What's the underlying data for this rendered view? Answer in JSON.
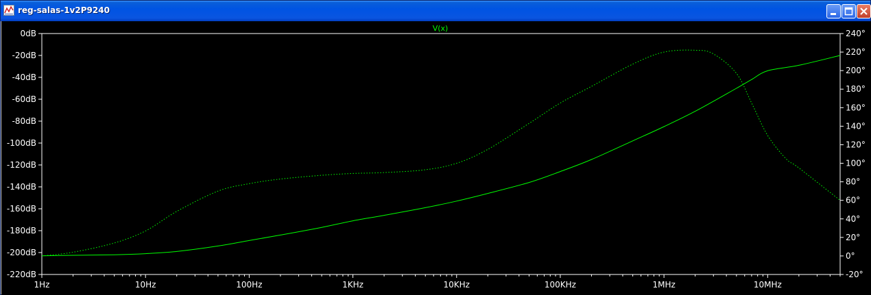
{
  "window": {
    "title": "reg-salas-1v2P9240",
    "icon": "waveform-viewer-icon",
    "buttons": {
      "minimize": "minimize-icon",
      "maximize": "maximize-icon",
      "close": "close-icon"
    }
  },
  "colors": {
    "background": "#000000",
    "trace": "#00ff00",
    "text": "#ffffff",
    "titlebar": "#0054e3"
  },
  "chart_data": {
    "type": "line",
    "title": "V(x)",
    "x_scale": "log",
    "xlim": [
      1,
      50000000
    ],
    "x_ticks": [
      {
        "value": 1,
        "label": "1Hz"
      },
      {
        "value": 10,
        "label": "10Hz"
      },
      {
        "value": 100,
        "label": "100Hz"
      },
      {
        "value": 1000,
        "label": "1KHz"
      },
      {
        "value": 10000,
        "label": "10KHz"
      },
      {
        "value": 100000,
        "label": "100KHz"
      },
      {
        "value": 1000000,
        "label": "1MHz"
      },
      {
        "value": 10000000,
        "label": "10MHz"
      }
    ],
    "y_left": {
      "ylim": [
        -220,
        0
      ],
      "ticks": [
        {
          "value": 0,
          "label": "0dB"
        },
        {
          "value": -20,
          "label": "-20dB"
        },
        {
          "value": -40,
          "label": "-40dB"
        },
        {
          "value": -60,
          "label": "-60dB"
        },
        {
          "value": -80,
          "label": "-80dB"
        },
        {
          "value": -100,
          "label": "-100dB"
        },
        {
          "value": -120,
          "label": "-120dB"
        },
        {
          "value": -140,
          "label": "-140dB"
        },
        {
          "value": -160,
          "label": "-160dB"
        },
        {
          "value": -180,
          "label": "-180dB"
        },
        {
          "value": -200,
          "label": "-200dB"
        },
        {
          "value": -220,
          "label": "-220dB"
        }
      ]
    },
    "y_right": {
      "ylim": [
        -20,
        240
      ],
      "ticks": [
        {
          "value": 240,
          "label": "240°"
        },
        {
          "value": 220,
          "label": "220°"
        },
        {
          "value": 200,
          "label": "200°"
        },
        {
          "value": 180,
          "label": "180°"
        },
        {
          "value": 160,
          "label": "160°"
        },
        {
          "value": 140,
          "label": "140°"
        },
        {
          "value": 120,
          "label": "120°"
        },
        {
          "value": 100,
          "label": "100°"
        },
        {
          "value": 80,
          "label": "80°"
        },
        {
          "value": 60,
          "label": "60°"
        },
        {
          "value": 40,
          "label": "40°"
        },
        {
          "value": 20,
          "label": "20°"
        },
        {
          "value": 0,
          "label": "0°"
        },
        {
          "value": -20,
          "label": "-20°"
        }
      ]
    },
    "grid": false,
    "series": [
      {
        "axis": "left",
        "style": "solid",
        "x": [
          1,
          2,
          5,
          10,
          20,
          50,
          100,
          200,
          500,
          1000,
          2000,
          5000,
          10000,
          20000,
          50000,
          100000,
          200000,
          500000,
          1000000,
          2000000,
          5000000,
          7000000,
          10000000,
          20000000,
          50000000
        ],
        "y": [
          -203,
          -202.5,
          -202,
          -201,
          -199,
          -194,
          -189,
          -184,
          -177,
          -171,
          -166,
          -159,
          -153,
          -146,
          -136,
          -126,
          -115,
          -98,
          -85,
          -71,
          -50,
          -42,
          -34,
          -29,
          -20
        ]
      },
      {
        "axis": "right",
        "style": "dotted",
        "x": [
          1,
          2,
          5,
          10,
          20,
          50,
          100,
          200,
          500,
          1000,
          2000,
          5000,
          10000,
          20000,
          50000,
          100000,
          200000,
          500000,
          1000000,
          2000000,
          3000000,
          5000000,
          7000000,
          10000000,
          15000000,
          20000000,
          50000000
        ],
        "y": [
          0,
          4,
          14,
          27,
          48,
          70,
          78,
          83,
          87,
          89,
          90,
          93,
          100,
          115,
          143,
          165,
          183,
          207,
          220,
          222,
          218,
          197,
          165,
          130,
          105,
          95,
          60
        ]
      }
    ]
  }
}
